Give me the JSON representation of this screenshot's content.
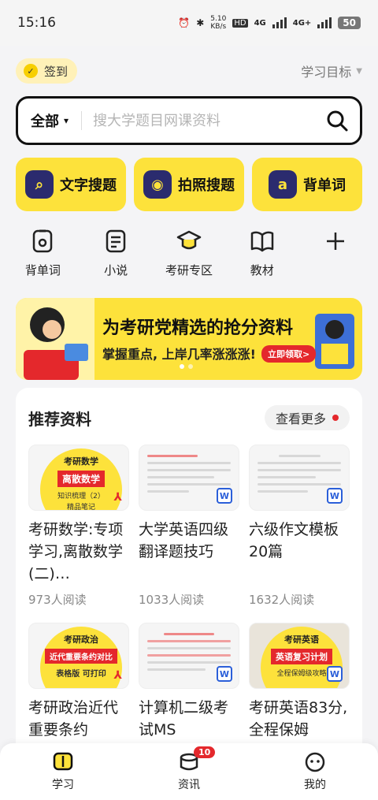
{
  "status": {
    "time": "15:16",
    "net_speed": "5.10",
    "net_unit": "KB/s",
    "hd": "HD",
    "sig1": "4G",
    "sig2": "4G+",
    "battery": "50"
  },
  "header": {
    "checkin_label": "签到",
    "goal_label": "学习目标"
  },
  "search": {
    "scope": "全部",
    "placeholder": "搜大学题目网课资料"
  },
  "quick": [
    {
      "label": "文字搜题",
      "icon": "text-search-icon"
    },
    {
      "label": "拍照搜题",
      "icon": "camera-icon"
    },
    {
      "label": "背单词",
      "icon": "word-icon"
    }
  ],
  "icons": [
    {
      "label": "背单词",
      "icon": "vocabulary-icon"
    },
    {
      "label": "小说",
      "icon": "novel-icon"
    },
    {
      "label": "考研专区",
      "icon": "graduation-cap-icon"
    },
    {
      "label": "教材",
      "icon": "book-icon"
    },
    {
      "label": "",
      "icon": "plus-icon"
    }
  ],
  "banner": {
    "title": "为考研党精选的抢分资料",
    "subtitle": "掌握重点, 上岸几率涨涨涨!",
    "cta": "立即领取>"
  },
  "recommend": {
    "title": "推荐资料",
    "more_label": "查看更多",
    "docs": [
      {
        "name": "考研数学:专项学习,离散数学(二)…",
        "reads": "973人阅读",
        "type": "pdf",
        "cover_top": "考研数学",
        "cover_mid": "离散数学",
        "cover_bot": "知识梳理（2）",
        "cover_bot2": "精品笔记"
      },
      {
        "name": "大学英语四级翻译题技巧",
        "reads": "1033人阅读",
        "type": "word"
      },
      {
        "name": "六级作文模板20篇",
        "reads": "1632人阅读",
        "type": "word"
      },
      {
        "name": "考研政治近代重要条约",
        "reads": "",
        "type": "pdf",
        "cover_top": "考研政治",
        "cover_mid": "近代重要条约对比",
        "cover_bot": "表格版 可打印"
      },
      {
        "name": "计算机二级考试MS",
        "reads": "",
        "type": "word"
      },
      {
        "name": "考研英语83分,全程保姆",
        "reads": "",
        "type": "word",
        "cover_top": "考研英语",
        "cover_mid": "英语复习计划",
        "cover_bot": "全程保姆级攻略"
      }
    ]
  },
  "tabs": [
    {
      "label": "学习",
      "icon": "study-book-icon"
    },
    {
      "label": "资讯",
      "icon": "news-icon",
      "badge": "10"
    },
    {
      "label": "我的",
      "icon": "profile-icon"
    }
  ]
}
